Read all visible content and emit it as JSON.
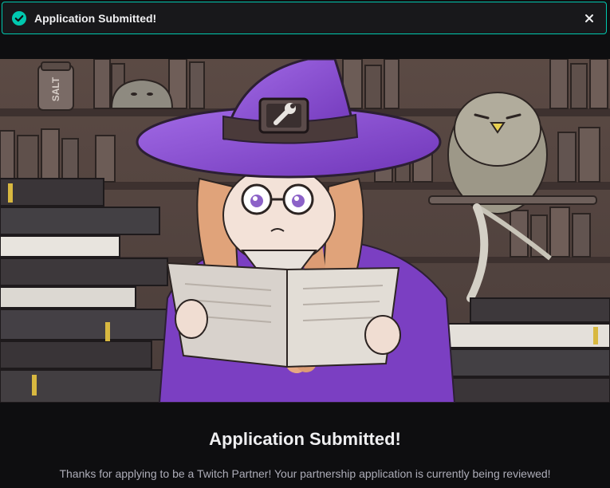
{
  "toast": {
    "message": "Application Submitted!",
    "status_icon": "check-circle-icon",
    "close_icon": "close-icon",
    "accent_color": "#00c8af"
  },
  "hero": {
    "jar_label": "SALT",
    "hat_emblem_icon": "wrench-icon",
    "hat_color": "#8b4bd6"
  },
  "main": {
    "heading": "Application Submitted!",
    "message": "Thanks for applying to be a Twitch Partner! Your partnership application is currently being reviewed!"
  }
}
